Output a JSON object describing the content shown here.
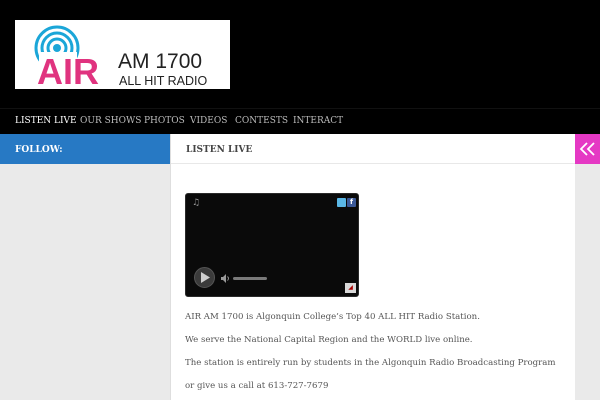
{
  "logo": {
    "brand": "AIR",
    "frequency": "AM 1700",
    "tagline": "ALL HIT RADIO",
    "colors": {
      "pink": "#e0337f",
      "blue": "#1ba6d8",
      "dark": "#222222"
    }
  },
  "nav": {
    "items": [
      {
        "label": "LISTEN LIVE",
        "active": true
      },
      {
        "label": "OUR SHOWS"
      },
      {
        "label": "PHOTOS"
      },
      {
        "label": "VIDEOS"
      },
      {
        "label": "CONTESTS"
      },
      {
        "label": "INTERACT"
      }
    ]
  },
  "sidebar": {
    "follow_label": "FOLLOW:"
  },
  "main": {
    "title": "LISTEN LIVE",
    "paragraphs": [
      "AIR AM 1700  is Algonquin College’s  Top 40 ALL HIT Radio Station.",
      "We serve the National Capital Region and the WORLD live online.",
      "The station is entirely run by students in the Algonquin Radio Broadcasting Program",
      "or give us a call at 613-727-7679"
    ]
  },
  "player": {
    "icons": [
      "music-note-icon",
      "twitter-icon",
      "facebook-icon",
      "play-icon",
      "volume-icon"
    ]
  },
  "toggle": {
    "icon": "double-chevron-left-icon"
  },
  "colors": {
    "follow_bar": "#2779c4",
    "toggle": "#e539c4",
    "header_bg": "#000000",
    "content_bg": "#eaeaea"
  }
}
